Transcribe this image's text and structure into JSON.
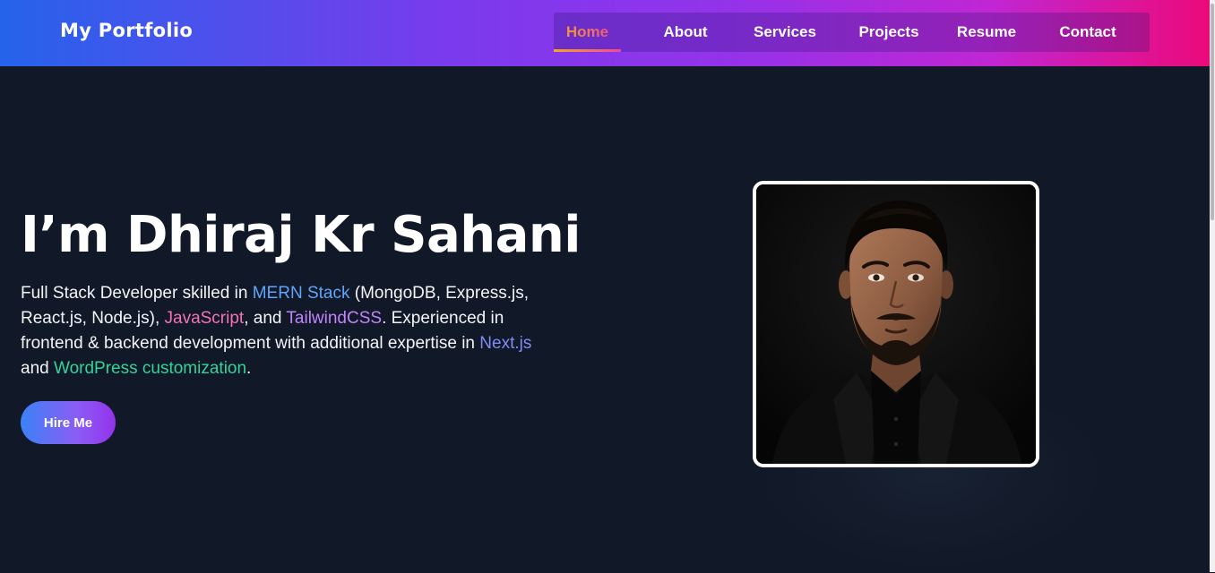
{
  "header": {
    "logo": "My Portfolio",
    "nav": [
      {
        "label": "Home",
        "active": true
      },
      {
        "label": "About",
        "active": false
      },
      {
        "label": "Services",
        "active": false
      },
      {
        "label": "Projects",
        "active": false
      },
      {
        "label": "Resume",
        "active": false
      },
      {
        "label": "Contact",
        "active": false
      }
    ]
  },
  "hero": {
    "title": "I’m Dhiraj Kr Sahani",
    "description": {
      "p1": "Full Stack Developer skilled in ",
      "mern": "MERN Stack",
      "p2": " (MongoDB, Express.js, React.js, Node.js), ",
      "js": "JavaScript",
      "p3": ", and ",
      "tailwind": "TailwindCSS",
      "p4": ". Experienced in frontend & backend development with additional expertise in ",
      "next": "Next.js",
      "p5": " and ",
      "wp": "WordPress customization",
      "p6": "."
    },
    "cta_label": "Hire Me",
    "photo_icon": "profile-photo"
  },
  "colors": {
    "background": "#111827",
    "header_start": "#2563eb",
    "header_end": "#ec0a7a",
    "accent_blue": "#60a5fa",
    "accent_pink": "#f472b6",
    "accent_purple": "#c084fc",
    "accent_indigo": "#818cf8",
    "accent_green": "#34d399"
  }
}
